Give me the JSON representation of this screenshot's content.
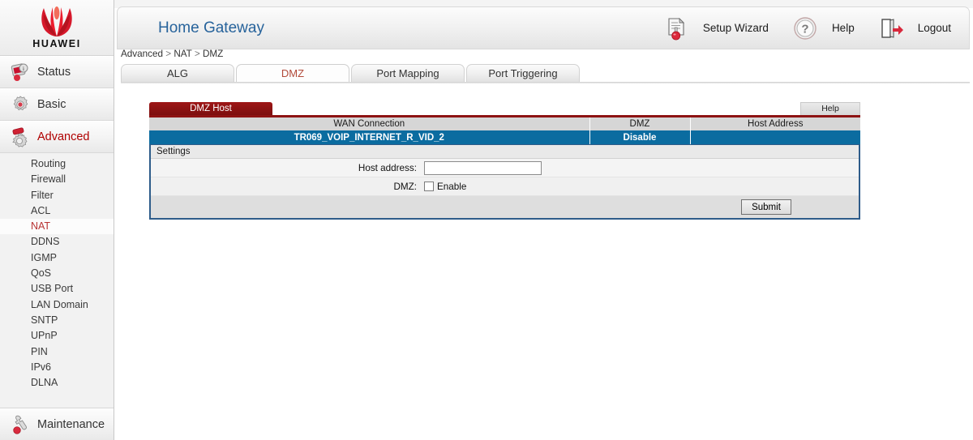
{
  "brand": {
    "logo_word": "HUAWEI",
    "logo_icon": "huawei-flower-logo"
  },
  "header": {
    "title": "Home Gateway",
    "actions": [
      {
        "label": "Setup Wizard",
        "icon": "setup-wizard-icon"
      },
      {
        "label": "Help",
        "icon": "question-circle-icon"
      },
      {
        "label": "Logout",
        "icon": "exit-door-icon"
      }
    ]
  },
  "breadcrumb": {
    "part1": "Advanced",
    "sep1": ">",
    "part2": "NAT",
    "sep2": ">",
    "part3": "DMZ"
  },
  "tabs": [
    {
      "label": "ALG",
      "active": false
    },
    {
      "label": "DMZ",
      "active": true
    },
    {
      "label": "Port Mapping",
      "active": false
    },
    {
      "label": "Port Triggering",
      "active": false
    }
  ],
  "sidebar": {
    "main": [
      {
        "label": "Status",
        "icon": "status-info-icon",
        "active": false
      },
      {
        "label": "Basic",
        "icon": "gear-icon",
        "active": false
      },
      {
        "label": "Advanced",
        "icon": "advanced-gear-icon",
        "active": true
      }
    ],
    "sub_items": [
      {
        "label": "Routing",
        "active": false
      },
      {
        "label": "Firewall",
        "active": false
      },
      {
        "label": "Filter",
        "active": false
      },
      {
        "label": "ACL",
        "active": false
      },
      {
        "label": "NAT",
        "active": true
      },
      {
        "label": "DDNS",
        "active": false
      },
      {
        "label": "IGMP",
        "active": false
      },
      {
        "label": "QoS",
        "active": false
      },
      {
        "label": "USB Port",
        "active": false
      },
      {
        "label": "LAN Domain",
        "active": false
      },
      {
        "label": "SNTP",
        "active": false
      },
      {
        "label": "UPnP",
        "active": false
      },
      {
        "label": "PIN",
        "active": false
      },
      {
        "label": "IPv6",
        "active": false
      },
      {
        "label": "DLNA",
        "active": false
      }
    ],
    "bottom": {
      "label": "Maintenance",
      "icon": "wrench-icon"
    }
  },
  "panel": {
    "tab_label": "DMZ Host",
    "help_label": "Help",
    "table": {
      "headers": [
        "WAN Connection",
        "DMZ",
        "Host Address"
      ],
      "rows": [
        {
          "wan_connection": "TR069_VOIP_INTERNET_R_VID_2",
          "dmz": "Disable",
          "host_address": ""
        }
      ]
    },
    "settings": {
      "title": "Settings",
      "host_address_label": "Host address:",
      "host_address_value": "",
      "dmz_label": "DMZ:",
      "enable_label": "Enable",
      "enable_checked": false,
      "submit_label": "Submit"
    }
  },
  "colors": {
    "brand_red": "#c8102e",
    "accent_dark_red": "#8d1212",
    "row_blue": "#0b6ca0",
    "title_blue": "#27639b",
    "panel_border": "#2e5c8a"
  }
}
